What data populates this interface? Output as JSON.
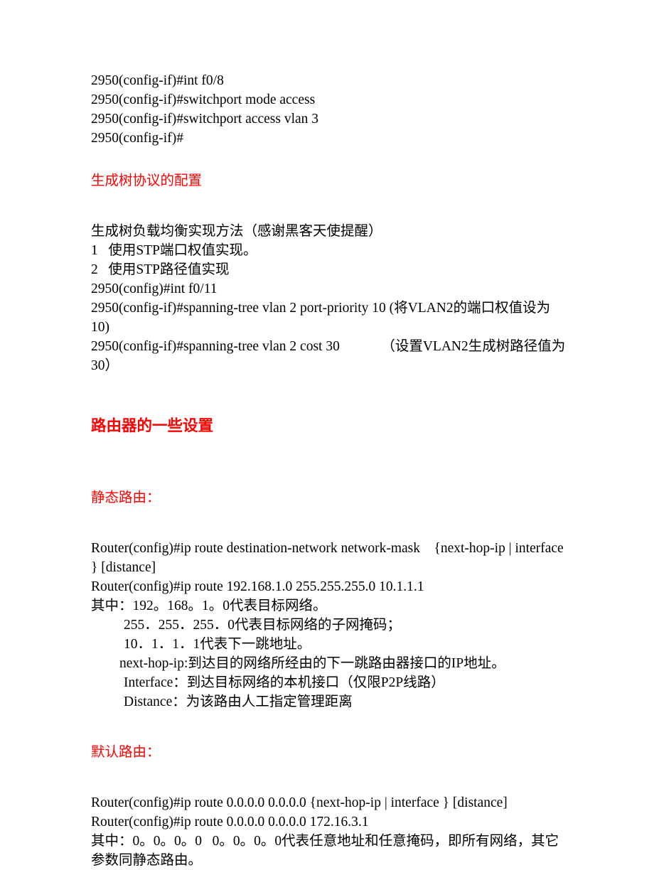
{
  "document": {
    "colors": {
      "text": "#000000",
      "heading_red": "#ff0000",
      "background": "#ffffff"
    },
    "switch_config": {
      "lines": [
        "2950(config-if)#int f0/8",
        "2950(config-if)#switchport mode access",
        "2950(config-if)#switchport access vlan 3",
        "2950(config-if)#"
      ]
    },
    "stp_section": {
      "heading": "生成树协议的配置",
      "intro": "生成树负载均衡实现方法（感谢黑客天使提醒）",
      "methods": [
        "1   使用STP端口权值实现。",
        "2   使用STP路径值实现"
      ],
      "commands": [
        "2950(config)#int f0/11",
        "2950(config-if)#spanning-tree vlan 2 port-priority 10 (将VLAN2的端口权值设为10)",
        "2950(config-if)#spanning-tree vlan 2 cost 30            （设置VLAN2生成树路径值为30）"
      ]
    },
    "router_section": {
      "heading": "路由器的一些设置",
      "static_route": {
        "heading": "静态路由：",
        "syntax": "Router(config)#ip route destination-network network-mask    {next-hop-ip | interface } [distance]",
        "example": "Router(config)#ip route 192.168.1.0 255.255.255.0 10.1.1.1",
        "explain_lead": "其中：192。168。1。0代表目标网络。",
        "explain_items": [
          "255．255．255．0代表目标网络的子网掩码；",
          "10．1．1．1代表下一跳地址。"
        ],
        "param_items": [
          "next-hop-ip:到达目的网络所经由的下一跳路由器接口的IP地址。",
          "Interface：到达目标网络的本机接口（仅限P2P线路）",
          "Distance：为该路由人工指定管理距离"
        ]
      },
      "default_route": {
        "heading": "默认路由：",
        "syntax": "Router(config)#ip route 0.0.0.0 0.0.0.0 {next-hop-ip | interface } [distance]",
        "example": "Router(config)#ip route 0.0.0.0 0.0.0.0 172.16.3.1",
        "explain": "其中：0。0。0。0   0。0。0。0代表任意地址和任意掩码，即所有网络，其它参数同静态路由。"
      }
    }
  }
}
